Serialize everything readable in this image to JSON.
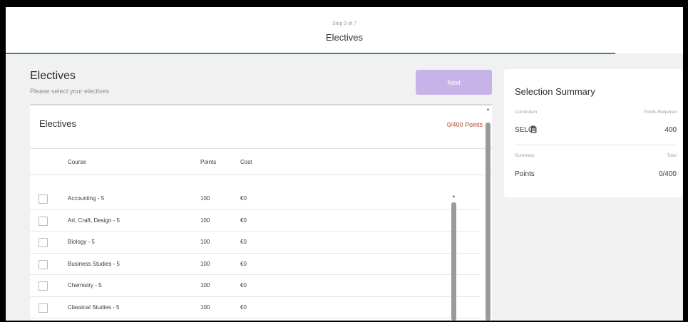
{
  "header": {
    "step": "Step 3 of 7",
    "title": "Electives"
  },
  "page": {
    "heading": "Electives",
    "subheading": "Please select your electives",
    "next_label": "Next"
  },
  "electives_card": {
    "title": "Electives",
    "points_status": "0/400 Points",
    "columns": [
      "Course",
      "Points",
      "Cost"
    ],
    "rows": [
      {
        "course": "Accounting - 5",
        "points": "100",
        "cost": "€0",
        "checked": false
      },
      {
        "course": "Art, Craft, Design - 5",
        "points": "100",
        "cost": "€0",
        "checked": false
      },
      {
        "course": "Biology - 5",
        "points": "100",
        "cost": "€0",
        "checked": false
      },
      {
        "course": "Business Studies - 5",
        "points": "100",
        "cost": "€0",
        "checked": false
      },
      {
        "course": "Chemistry - 5",
        "points": "100",
        "cost": "€0",
        "checked": false
      },
      {
        "course": "Classical Studies - 5",
        "points": "100",
        "cost": "€0",
        "checked": false
      }
    ]
  },
  "summary": {
    "title": "Selection Summary",
    "curriculum_label": "Curriculum",
    "points_required_label": "Points Required",
    "curriculum_value": "SELC",
    "curriculum_icon": "document-icon",
    "points_required_value": "400",
    "summary_label": "Summary",
    "total_label": "Total",
    "points_label": "Points",
    "points_value": "0/400"
  },
  "colors": {
    "accent_progress": "#2f8f73",
    "next_button": "#c8b3e8",
    "points_status": "#b44a2c"
  }
}
